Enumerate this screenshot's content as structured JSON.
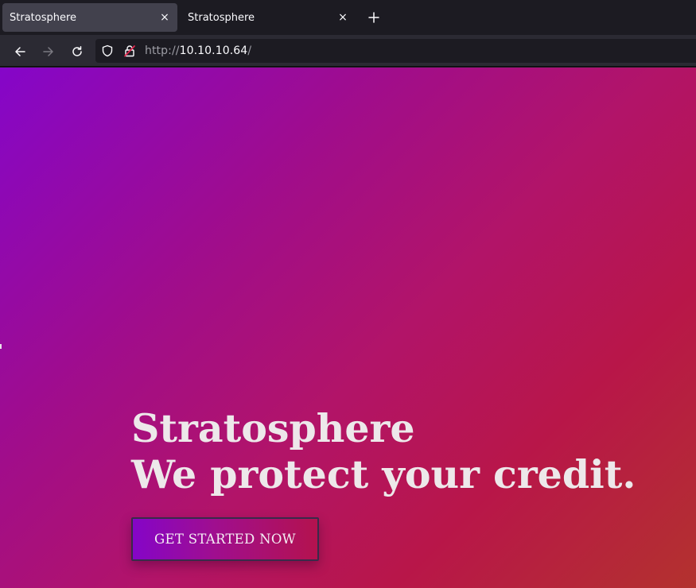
{
  "browser": {
    "tabs": [
      {
        "title": "Stratosphere",
        "active": true
      },
      {
        "title": "Stratosphere",
        "active": false
      }
    ],
    "tab_close_glyph": "×",
    "url": {
      "scheme": "http://",
      "host": "10.10.10.64",
      "path": "/"
    }
  },
  "icons": {
    "back": "arrow-left-icon",
    "forward": "arrow-right-icon",
    "reload": "reload-icon",
    "tracking": "shield-icon",
    "insecure": "insecure-lock-icon",
    "new_tab": "plus-icon"
  },
  "page": {
    "hero": {
      "line1": "Stratosphere",
      "line2": "We protect your credit."
    },
    "cta_label": "GET STARTED NOW"
  },
  "colors": {
    "gradient_start": "#8506c9",
    "gradient_mid": "#b21468",
    "gradient_end": "#b3322e",
    "hero_text": "#ede8ea"
  }
}
